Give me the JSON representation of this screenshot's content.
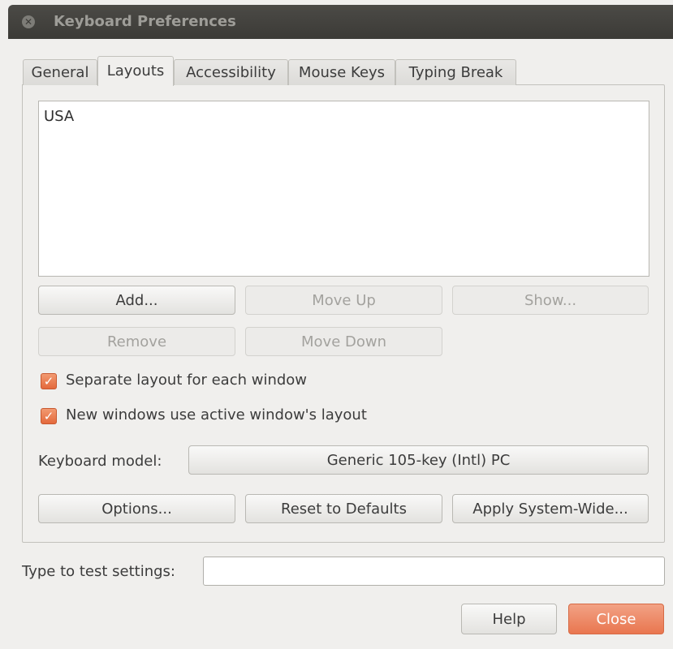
{
  "window": {
    "title": "Keyboard Preferences"
  },
  "tabs": [
    {
      "label": "General"
    },
    {
      "label": "Layouts",
      "active": true
    },
    {
      "label": "Accessibility"
    },
    {
      "label": "Mouse Keys"
    },
    {
      "label": "Typing Break"
    }
  ],
  "layouts": {
    "items": [
      "USA"
    ]
  },
  "buttons": {
    "add": "Add...",
    "move_up": "Move Up",
    "show": "Show...",
    "remove": "Remove",
    "move_down": "Move Down",
    "options": "Options...",
    "reset": "Reset to Defaults",
    "apply": "Apply System-Wide...",
    "help": "Help",
    "close": "Close"
  },
  "checkboxes": [
    {
      "label": "Separate layout for each window",
      "checked": true
    },
    {
      "label": "New windows use active window's layout",
      "checked": true
    }
  ],
  "keyboard_model": {
    "label": "Keyboard model:",
    "value": "Generic 105-key (Intl) PC"
  },
  "test": {
    "label": "Type to test settings:",
    "value": ""
  },
  "colors": {
    "accent": "#e9764f",
    "titlebar": "#3c3b37",
    "background": "#f0efed"
  },
  "icons": {
    "title_close": "close-icon",
    "checkmark": "checkmark-icon"
  }
}
